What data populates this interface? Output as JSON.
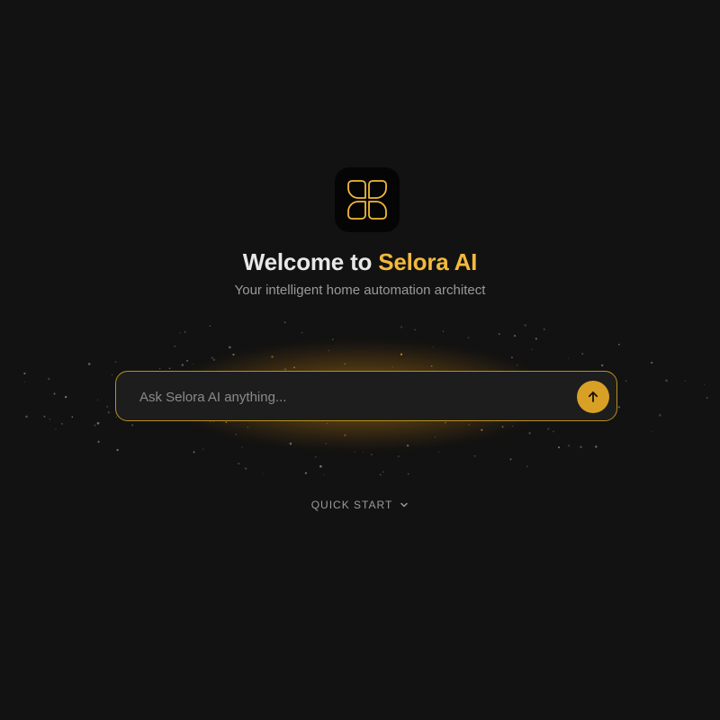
{
  "hero": {
    "title_prefix": "Welcome to ",
    "title_brand": "Selora AI",
    "subtitle": "Your intelligent home automation architect"
  },
  "search": {
    "placeholder": "Ask Selora AI anything...",
    "value": ""
  },
  "quick_start": {
    "label": "QUICK START"
  },
  "icons": {
    "logo": "selora-logo-icon",
    "send": "arrow-up-icon",
    "expand": "chevron-down-icon"
  },
  "colors": {
    "background": "#121212",
    "accent": "#f2b93b",
    "send_button": "#d8a025",
    "input_border": "#b8901f"
  }
}
